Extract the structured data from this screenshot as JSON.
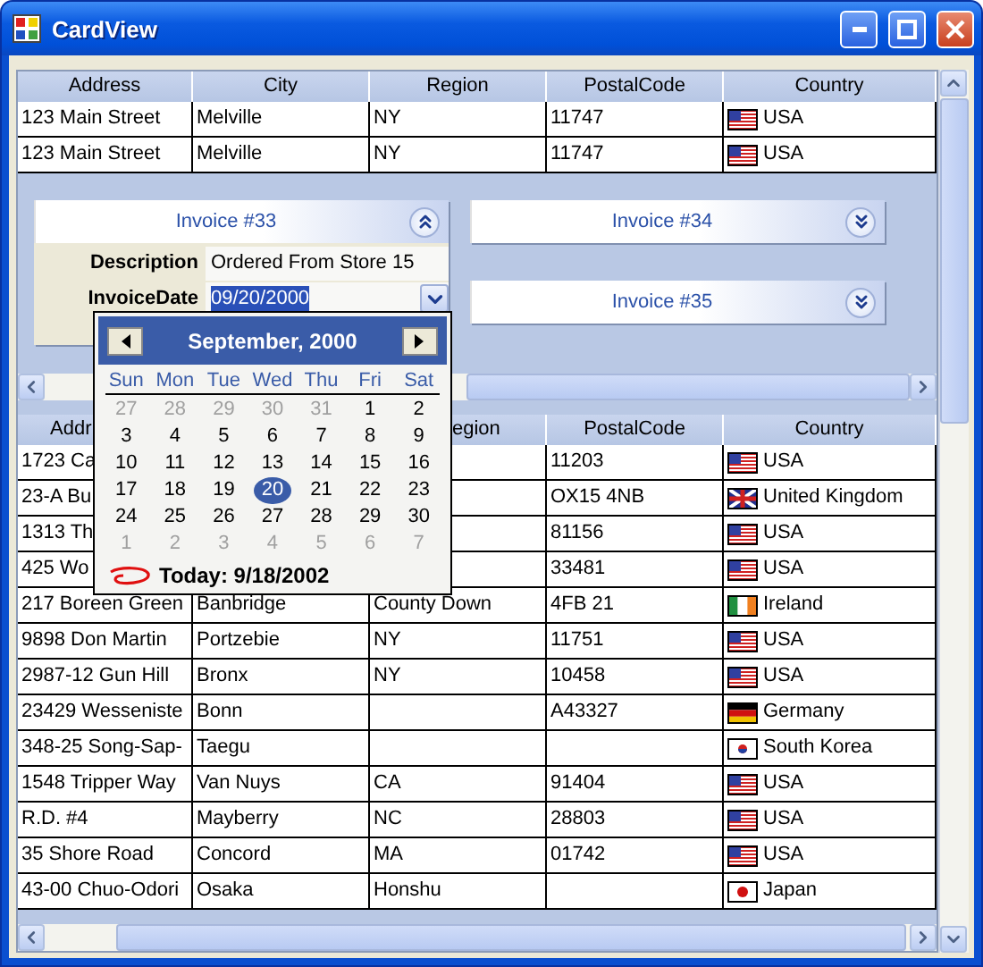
{
  "window": {
    "title": "CardView"
  },
  "top_grid": {
    "columns": {
      "address": "Address",
      "city": "City",
      "region": "Region",
      "postal": "PostalCode",
      "country": "Country"
    },
    "rows": [
      {
        "address": "123 Main Street",
        "city": "Melville",
        "region": "NY",
        "postal": "11747",
        "country": "USA",
        "kind": "us"
      },
      {
        "address": "123 Main Street",
        "city": "Melville",
        "region": "NY",
        "postal": "11747",
        "country": "USA",
        "kind": "us"
      }
    ]
  },
  "cards": [
    {
      "title": "Invoice #33",
      "expanded": true,
      "fields": [
        {
          "kind": "text",
          "label": "Description",
          "value": "Ordered From Store 15"
        },
        {
          "kind": "date",
          "label": "InvoiceDate",
          "value": "09/20/2000"
        }
      ]
    },
    {
      "title": "Invoice #34",
      "expanded": false
    },
    {
      "title": "Invoice #35",
      "expanded": false
    }
  ],
  "bottom_grid": {
    "columns": {
      "address": "Addr",
      "region": "egion",
      "postal": "PostalCode",
      "country": "Country"
    },
    "rows": [
      {
        "address": "1723 Ca",
        "postal": "11203",
        "country": "USA",
        "kind": "us"
      },
      {
        "address": "23-A Bu",
        "postal": "OX15 4NB",
        "country": "United Kingdom",
        "kind": "gb"
      },
      {
        "address": "1313 Th",
        "postal": "81156",
        "country": "USA",
        "kind": "us"
      },
      {
        "address": "425 Wo",
        "postal": "33481",
        "country": "USA",
        "kind": "us"
      },
      {
        "address": "217 Boreen Green",
        "city": "Banbridge",
        "region": "County Down",
        "postal": "4FB 21",
        "country": "Ireland",
        "kind": "ie"
      },
      {
        "address": "9898 Don Martin",
        "city": "Portzebie",
        "region": "NY",
        "postal": "11751",
        "country": "USA",
        "kind": "us"
      },
      {
        "address": "2987-12 Gun Hill",
        "city": "Bronx",
        "region": "NY",
        "postal": "10458",
        "country": "USA",
        "kind": "us"
      },
      {
        "address": "23429 Wesseniste",
        "city": "Bonn",
        "postal": "A43327",
        "country": "Germany",
        "kind": "de"
      },
      {
        "address": "348-25 Song-Sap-",
        "city": "Taegu",
        "country": "South Korea",
        "kind": "kr"
      },
      {
        "address": "1548 Tripper Way",
        "city": "Van Nuys",
        "region": "CA",
        "postal": "91404",
        "country": "USA",
        "kind": "us"
      },
      {
        "address": "R.D. #4",
        "city": "Mayberry",
        "region": "NC",
        "postal": "28803",
        "country": "USA",
        "kind": "us"
      },
      {
        "address": "35 Shore Road",
        "city": "Concord",
        "region": "MA",
        "postal": "01742",
        "country": "USA",
        "kind": "us"
      },
      {
        "address": "43-00 Chuo-Odori",
        "city": "Osaka",
        "region": "Honshu",
        "country": "Japan",
        "kind": "jp"
      }
    ]
  },
  "calendar": {
    "month": "September, 2000",
    "weekdays": [
      "Sun",
      "Mon",
      "Tue",
      "Wed",
      "Thu",
      "Fri",
      "Sat"
    ],
    "weeks": [
      [
        {
          "day": "27",
          "other": true,
          "selected": false
        },
        {
          "day": "28",
          "other": true,
          "selected": false
        },
        {
          "day": "29",
          "other": true,
          "selected": false
        },
        {
          "day": "30",
          "other": true,
          "selected": false
        },
        {
          "day": "31",
          "other": true,
          "selected": false
        },
        {
          "day": "1",
          "other": false,
          "selected": false
        },
        {
          "day": "2",
          "other": false,
          "selected": false
        }
      ],
      [
        {
          "day": "3",
          "other": false,
          "selected": false
        },
        {
          "day": "4",
          "other": false,
          "selected": false
        },
        {
          "day": "5",
          "other": false,
          "selected": false
        },
        {
          "day": "6",
          "other": false,
          "selected": false
        },
        {
          "day": "7",
          "other": false,
          "selected": false
        },
        {
          "day": "8",
          "other": false,
          "selected": false
        },
        {
          "day": "9",
          "other": false,
          "selected": false
        }
      ],
      [
        {
          "day": "10",
          "other": false,
          "selected": false
        },
        {
          "day": "11",
          "other": false,
          "selected": false
        },
        {
          "day": "12",
          "other": false,
          "selected": false
        },
        {
          "day": "13",
          "other": false,
          "selected": false
        },
        {
          "day": "14",
          "other": false,
          "selected": false
        },
        {
          "day": "15",
          "other": false,
          "selected": false
        },
        {
          "day": "16",
          "other": false,
          "selected": false
        }
      ],
      [
        {
          "day": "17",
          "other": false,
          "selected": false
        },
        {
          "day": "18",
          "other": false,
          "selected": false
        },
        {
          "day": "19",
          "other": false,
          "selected": false
        },
        {
          "day": "20",
          "other": false,
          "selected": true
        },
        {
          "day": "21",
          "other": false,
          "selected": false
        },
        {
          "day": "22",
          "other": false,
          "selected": false
        },
        {
          "day": "23",
          "other": false,
          "selected": false
        }
      ],
      [
        {
          "day": "24",
          "other": false,
          "selected": false
        },
        {
          "day": "25",
          "other": false,
          "selected": false
        },
        {
          "day": "26",
          "other": false,
          "selected": false
        },
        {
          "day": "27",
          "other": false,
          "selected": false
        },
        {
          "day": "28",
          "other": false,
          "selected": false
        },
        {
          "day": "29",
          "other": false,
          "selected": false
        },
        {
          "day": "30",
          "other": false,
          "selected": false
        }
      ],
      [
        {
          "day": "1",
          "other": true,
          "selected": false
        },
        {
          "day": "2",
          "other": true,
          "selected": false
        },
        {
          "day": "3",
          "other": true,
          "selected": false
        },
        {
          "day": "4",
          "other": true,
          "selected": false
        },
        {
          "day": "5",
          "other": true,
          "selected": false
        },
        {
          "day": "6",
          "other": true,
          "selected": false
        },
        {
          "day": "7",
          "other": true,
          "selected": false
        }
      ]
    ],
    "today": "Today: 9/18/2002"
  }
}
